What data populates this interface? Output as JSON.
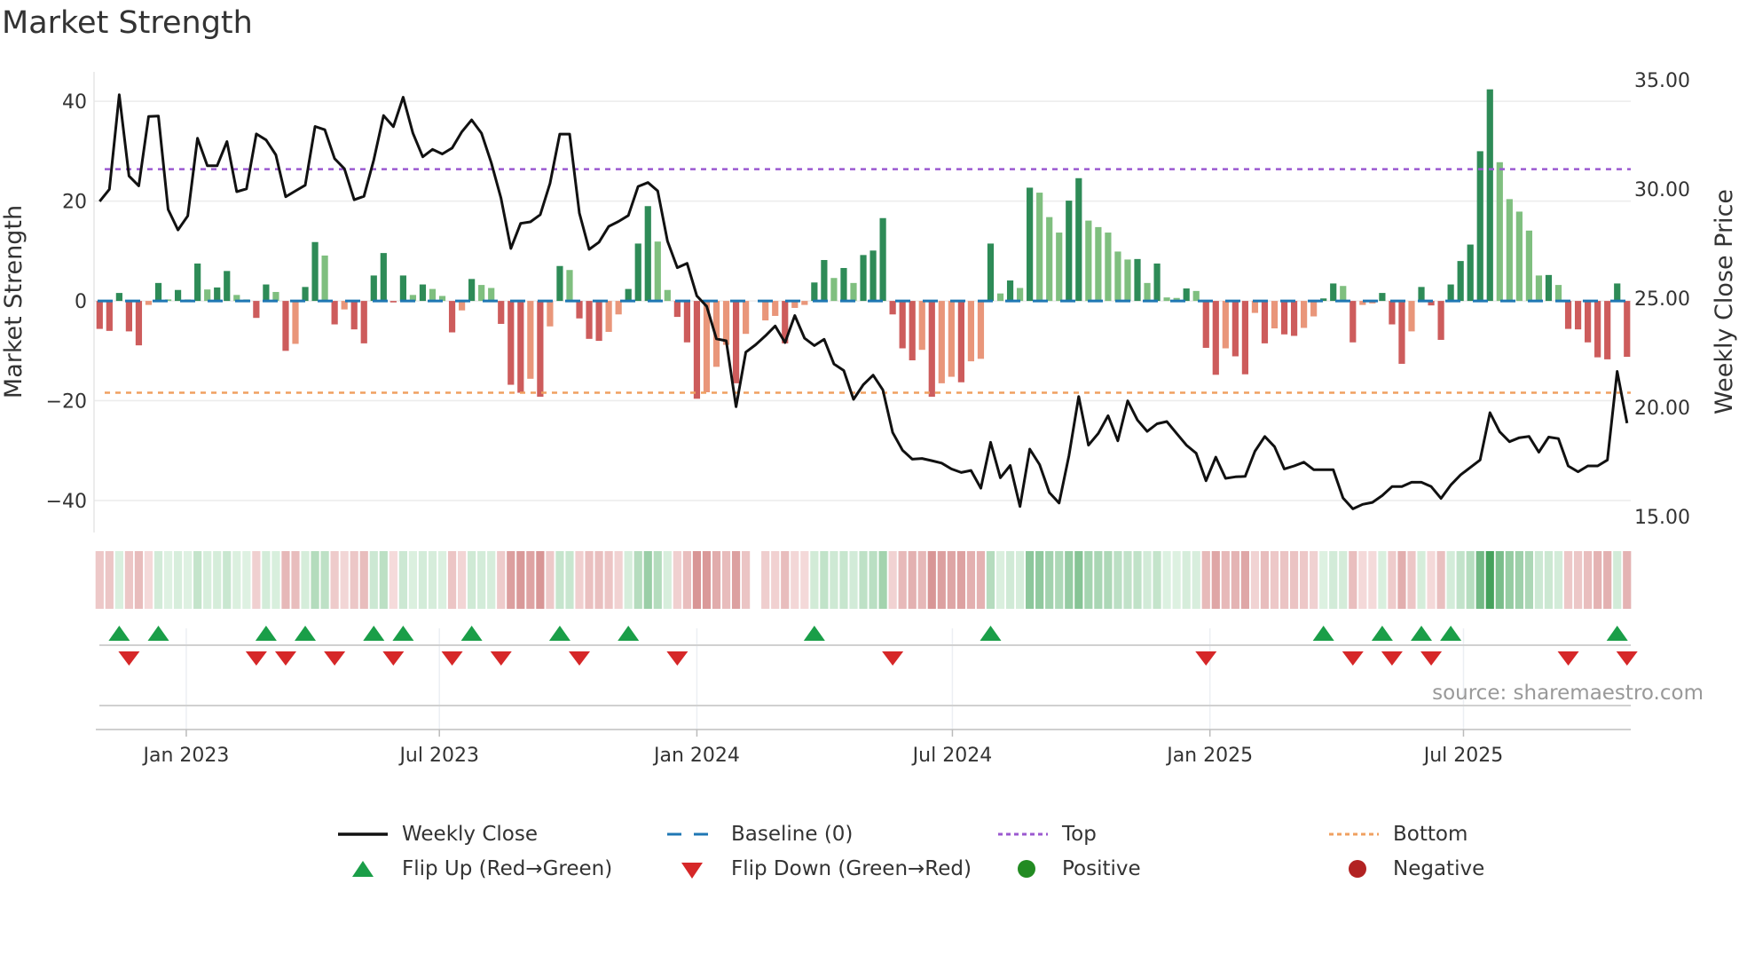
{
  "title": "Market Strength",
  "source": "source: sharemaestro.com",
  "colors": {
    "pos_strong": "#2e8b57",
    "pos_weak": "#7fbf7f",
    "neg_strong": "#cd5c5c",
    "neg_weak": "#e9967a",
    "line": "#111111",
    "baseline": "#1f77b4",
    "top": "#9b59d0",
    "bottom": "#f0a060",
    "flip_up": "#1a9e48",
    "flip_down": "#d62728",
    "positive": "#228b22",
    "negative": "#b22222"
  },
  "chart_data": {
    "type": "bar",
    "title": "Market Strength",
    "left_axis": {
      "label": "Market Strength",
      "ticks": [
        40,
        20,
        0,
        -20,
        -40
      ],
      "tick_labels": [
        "40",
        "20",
        "0",
        "−20",
        "−40"
      ],
      "ylim": [
        -46.4,
        45.9
      ]
    },
    "right_axis": {
      "label": "Weekly Close Price",
      "ticks": [
        35,
        30,
        25,
        20,
        15
      ],
      "tick_labels": [
        "35.00",
        "30.00",
        "25.00",
        "20.00",
        "15.00"
      ],
      "ylim": [
        14.27,
        35.37
      ]
    },
    "x_ticks": [
      {
        "label": "Jan 2023",
        "week": 8.85
      },
      {
        "label": "Jul 2023",
        "week": 34.7
      },
      {
        "label": "Jan 2024",
        "week": 61.0
      },
      {
        "label": "Jul 2024",
        "week": 87.1
      },
      {
        "label": "Jan 2025",
        "week": 113.4
      },
      {
        "label": "Jul 2025",
        "week": 139.3
      }
    ],
    "thresholds": {
      "top": 26.4,
      "bottom": -18.4,
      "baseline": 0
    },
    "strength": [
      -5.6,
      -6.0,
      1.6,
      -6.1,
      -8.9,
      -0.8,
      3.6,
      0.3,
      2.2,
      0.3,
      7.5,
      2.3,
      2.7,
      6.0,
      1.2,
      0.3,
      -3.4,
      3.3,
      1.8,
      -10.0,
      -8.6,
      2.8,
      11.8,
      9.1,
      -4.7,
      -1.7,
      -5.7,
      -8.5,
      5.1,
      9.6,
      -0.3,
      5.1,
      1.2,
      3.3,
      2.4,
      1.0,
      -6.3,
      -1.9,
      4.4,
      3.2,
      2.6,
      -4.6,
      -16.8,
      -18.4,
      -15.6,
      -19.2,
      -5.1,
      7.0,
      6.2,
      -3.5,
      -7.6,
      -8.0,
      -6.2,
      -2.7,
      2.4,
      11.5,
      19.0,
      11.9,
      2.2,
      -3.2,
      -8.3,
      -19.6,
      -18.3,
      -13.2,
      -8.8,
      -16.5,
      -6.6,
      0,
      -3.9,
      -3.0,
      -8.5,
      -1.4,
      -0.8,
      3.7,
      8.2,
      4.6,
      6.6,
      3.6,
      9.2,
      10.1,
      16.6,
      -2.7,
      -9.5,
      -11.9,
      -9.8,
      -19.2,
      -16.5,
      -15.2,
      -16.3,
      -12.1,
      -11.6,
      11.5,
      1.5,
      4.1,
      2.6,
      22.7,
      21.7,
      16.8,
      13.7,
      20.1,
      24.6,
      16.1,
      14.8,
      13.7,
      9.9,
      8.3,
      8.4,
      3.6,
      7.5,
      0.7,
      0.6,
      2.5,
      2.0,
      -9.4,
      -14.8,
      -9.5,
      -11.1,
      -14.7,
      -2.4,
      -8.5,
      -5.5,
      -6.7,
      -7.0,
      -5.4,
      -3.1,
      0.5,
      3.5,
      3.0,
      -8.3,
      -0.8,
      -0.5,
      1.6,
      -4.7,
      -12.6,
      -6.1,
      2.8,
      -0.9,
      -7.8,
      3.3,
      8.0,
      11.3,
      30.0,
      42.4,
      27.8,
      20.4,
      17.9,
      14.1,
      5.1,
      5.2,
      3.2,
      -5.6,
      -5.7,
      -8.3,
      -11.3,
      -11.7,
      3.5,
      -11.2
    ],
    "weekly_close": [
      29.44,
      29.99,
      34.32,
      30.6,
      30.15,
      33.33,
      33.35,
      29.07,
      28.13,
      28.77,
      32.33,
      31.07,
      31.07,
      32.18,
      29.88,
      30.01,
      32.53,
      32.25,
      31.57,
      29.65,
      29.92,
      30.18,
      32.87,
      32.72,
      31.4,
      30.93,
      29.51,
      29.67,
      31.34,
      33.37,
      32.86,
      34.21,
      32.56,
      31.48,
      31.82,
      31.61,
      31.88,
      32.63,
      33.17,
      32.56,
      31.21,
      29.58,
      27.28,
      28.43,
      28.5,
      28.83,
      30.26,
      32.52,
      32.52,
      28.9,
      27.24,
      27.57,
      28.29,
      28.52,
      28.79,
      30.12,
      30.3,
      29.92,
      27.62,
      26.4,
      26.6,
      25.11,
      24.63,
      23.14,
      23.05,
      20.03,
      22.53,
      22.87,
      23.28,
      23.73,
      22.97,
      24.21,
      23.17,
      22.83,
      23.12,
      21.99,
      21.69,
      20.37,
      21.04,
      21.48,
      20.8,
      18.85,
      18.04,
      17.63,
      17.66,
      17.56,
      17.45,
      17.18,
      17.02,
      17.11,
      16.3,
      18.4,
      16.78,
      17.34,
      15.46,
      18.09,
      17.38,
      16.1,
      15.62,
      17.79,
      20.5,
      18.27,
      18.81,
      19.62,
      18.47,
      20.3,
      19.42,
      18.9,
      19.25,
      19.35,
      18.81,
      18.27,
      17.9,
      16.64,
      17.72,
      16.75,
      16.82,
      16.84,
      17.99,
      18.67,
      18.2,
      17.18,
      17.32,
      17.49,
      17.15,
      17.15,
      17.15,
      15.85,
      15.35,
      15.56,
      15.65,
      15.96,
      16.37,
      16.37,
      16.57,
      16.57,
      16.37,
      15.83,
      16.44,
      16.91,
      17.25,
      17.59,
      19.76,
      18.88,
      18.43,
      18.61,
      18.67,
      17.95,
      18.64,
      18.57,
      17.32,
      17.05,
      17.32,
      17.32,
      17.59,
      21.65,
      19.28
    ],
    "grid": true,
    "legend_position": "bottom",
    "legend": [
      {
        "key": "weekly_close",
        "label": "Weekly Close"
      },
      {
        "key": "baseline",
        "label": "Baseline (0)"
      },
      {
        "key": "top",
        "label": "Top"
      },
      {
        "key": "bottom",
        "label": "Bottom"
      },
      {
        "key": "flip_up",
        "label": "Flip Up (Red→Green)"
      },
      {
        "key": "flip_down",
        "label": "Flip Down (Green→Red)"
      },
      {
        "key": "positive",
        "label": "Positive"
      },
      {
        "key": "negative",
        "label": "Negative"
      }
    ]
  }
}
